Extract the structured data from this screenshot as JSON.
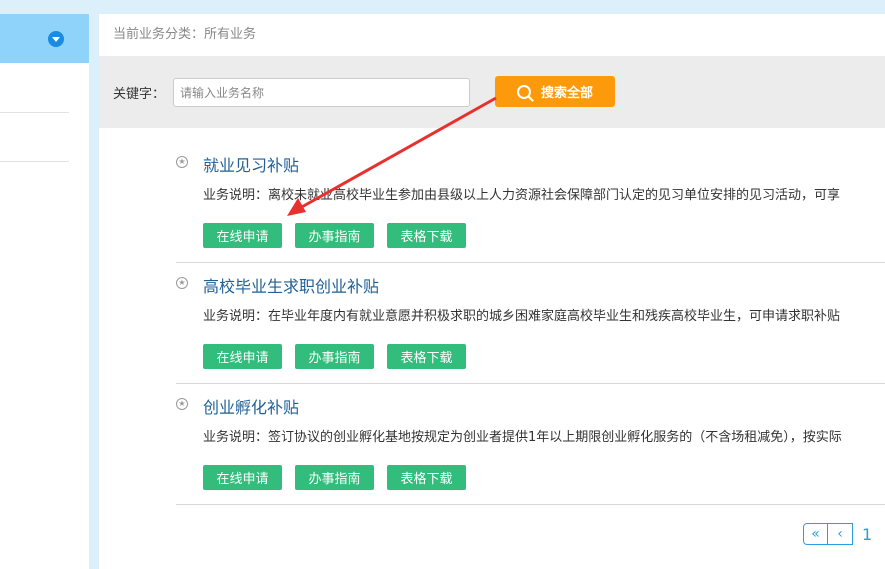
{
  "breadcrumb": "当前业务分类：所有业务",
  "search": {
    "label": "关键字：",
    "placeholder": "请输入业务名称",
    "button": "搜索全部"
  },
  "items": [
    {
      "title": "就业见习补贴",
      "desc": "业务说明：离校未就业高校毕业生参加由县级以上人力资源社会保障部门认定的见习单位安排的见习活动，可享"
    },
    {
      "title": "高校毕业生求职创业补贴",
      "desc": "业务说明：在毕业年度内有就业意愿并积极求职的城乡困难家庭高校毕业生和残疾高校毕业生，可申请求职补贴"
    },
    {
      "title": "创业孵化补贴",
      "desc": "业务说明：签订协议的创业孵化基地按规定为创业者提供1年以上期限创业孵化服务的（不含场租减免），按实际"
    }
  ],
  "buttons": {
    "apply": "在线申请",
    "guide": "办事指南",
    "download": "表格下载"
  },
  "pager": {
    "first": "«",
    "prev": "‹",
    "current": "1"
  },
  "colors": {
    "accent": "#32bd7c",
    "search": "#fc9a0c",
    "annotation": "#e8312f"
  }
}
